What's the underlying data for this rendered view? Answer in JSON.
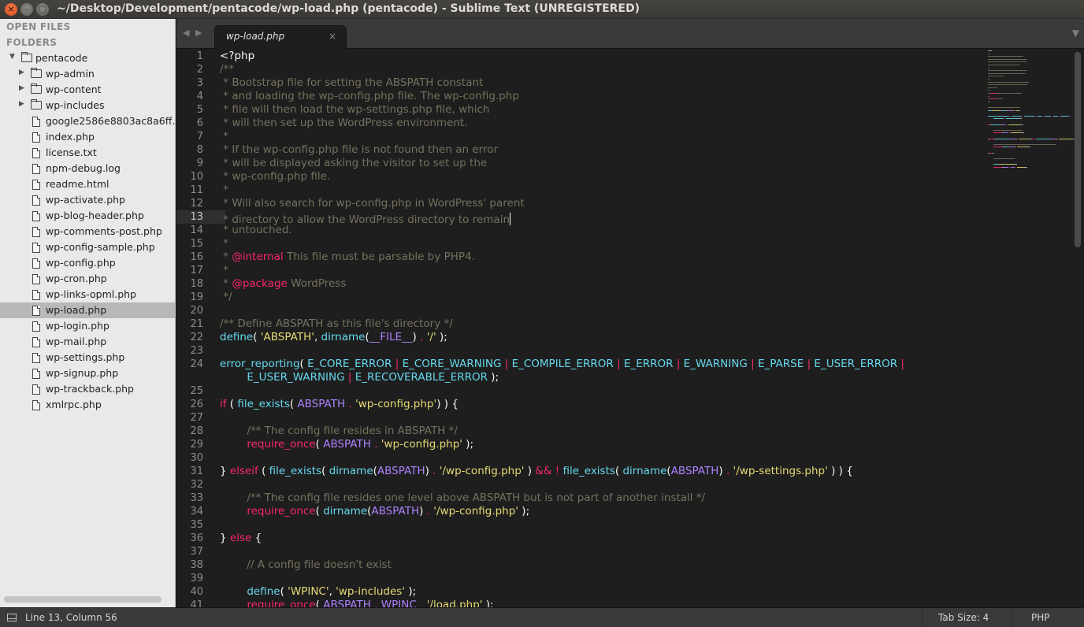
{
  "window": {
    "title": "~/Desktop/Development/pentacode/wp-load.php (pentacode) - Sublime Text (UNREGISTERED)",
    "close_glyph": "×",
    "min_glyph": "–",
    "max_glyph": "□"
  },
  "sidebar": {
    "open_files_label": "OPEN FILES",
    "folders_label": "FOLDERS",
    "root_folder": "pentacode",
    "items": [
      {
        "label": "wp-admin",
        "type": "folder"
      },
      {
        "label": "wp-content",
        "type": "folder"
      },
      {
        "label": "wp-includes",
        "type": "folder"
      },
      {
        "label": "google2586e8803ac8a6ff.html",
        "type": "file"
      },
      {
        "label": "index.php",
        "type": "file"
      },
      {
        "label": "license.txt",
        "type": "file"
      },
      {
        "label": "npm-debug.log",
        "type": "file"
      },
      {
        "label": "readme.html",
        "type": "file"
      },
      {
        "label": "wp-activate.php",
        "type": "file"
      },
      {
        "label": "wp-blog-header.php",
        "type": "file"
      },
      {
        "label": "wp-comments-post.php",
        "type": "file"
      },
      {
        "label": "wp-config-sample.php",
        "type": "file"
      },
      {
        "label": "wp-config.php",
        "type": "file"
      },
      {
        "label": "wp-cron.php",
        "type": "file"
      },
      {
        "label": "wp-links-opml.php",
        "type": "file"
      },
      {
        "label": "wp-load.php",
        "type": "file",
        "selected": true
      },
      {
        "label": "wp-login.php",
        "type": "file"
      },
      {
        "label": "wp-mail.php",
        "type": "file"
      },
      {
        "label": "wp-settings.php",
        "type": "file"
      },
      {
        "label": "wp-signup.php",
        "type": "file"
      },
      {
        "label": "wp-trackback.php",
        "type": "file"
      },
      {
        "label": "xmlrpc.php",
        "type": "file"
      }
    ]
  },
  "tabs": {
    "nav_prev": "◀",
    "nav_next": "▶",
    "active_tab": "wp-load.php",
    "close_glyph": "×",
    "dropdown_glyph": "▼"
  },
  "editor": {
    "current_line": 13,
    "lines": [
      {
        "n": "1",
        "t": [
          [
            "pl",
            "<?php"
          ]
        ]
      },
      {
        "n": "2",
        "t": [
          [
            "com",
            "/**"
          ]
        ]
      },
      {
        "n": "3",
        "t": [
          [
            "com",
            " * Bootstrap file for setting the ABSPATH constant"
          ]
        ]
      },
      {
        "n": "4",
        "t": [
          [
            "com",
            " * and loading the wp-config.php file. The wp-config.php"
          ]
        ]
      },
      {
        "n": "5",
        "t": [
          [
            "com",
            " * file will then load the wp-settings.php file, which"
          ]
        ]
      },
      {
        "n": "6",
        "t": [
          [
            "com",
            " * will then set up the WordPress environment."
          ]
        ]
      },
      {
        "n": "7",
        "t": [
          [
            "com",
            " *"
          ]
        ]
      },
      {
        "n": "8",
        "t": [
          [
            "com",
            " * If the wp-config.php file is not found then an error"
          ]
        ]
      },
      {
        "n": "9",
        "t": [
          [
            "com",
            " * will be displayed asking the visitor to set up the"
          ]
        ]
      },
      {
        "n": "10",
        "t": [
          [
            "com",
            " * wp-config.php file."
          ]
        ]
      },
      {
        "n": "11",
        "t": [
          [
            "com",
            " *"
          ]
        ]
      },
      {
        "n": "12",
        "t": [
          [
            "com",
            " * Will also search for wp-config.php in WordPress' parent"
          ]
        ]
      },
      {
        "n": "13",
        "t": [
          [
            "com",
            " * directory to allow the WordPress directory to remain"
          ]
        ]
      },
      {
        "n": "14",
        "t": [
          [
            "com",
            " * untouched."
          ]
        ]
      },
      {
        "n": "15",
        "t": [
          [
            "com",
            " *"
          ]
        ]
      },
      {
        "n": "16",
        "t": [
          [
            "com",
            " * "
          ],
          [
            "kw",
            "@internal"
          ],
          [
            "com",
            " This file must be parsable by PHP4."
          ]
        ]
      },
      {
        "n": "17",
        "t": [
          [
            "com",
            " *"
          ]
        ]
      },
      {
        "n": "18",
        "t": [
          [
            "com",
            " * "
          ],
          [
            "kw",
            "@package"
          ],
          [
            "com",
            " WordPress"
          ]
        ]
      },
      {
        "n": "19",
        "t": [
          [
            "com",
            " */"
          ]
        ]
      },
      {
        "n": "20",
        "t": []
      },
      {
        "n": "21",
        "t": [
          [
            "com",
            "/** Define ABSPATH as this file's directory */"
          ]
        ]
      },
      {
        "n": "22",
        "t": [
          [
            "fn",
            "define"
          ],
          [
            "pl",
            "( "
          ],
          [
            "str",
            "'ABSPATH'"
          ],
          [
            "pl",
            ", "
          ],
          [
            "fn",
            "dirname"
          ],
          [
            "pl",
            "("
          ],
          [
            "const",
            "__FILE__"
          ],
          [
            "pl",
            ") "
          ],
          [
            "op",
            "."
          ],
          [
            "pl",
            " "
          ],
          [
            "str",
            "'/'"
          ],
          [
            "pl",
            " );"
          ]
        ]
      },
      {
        "n": "23",
        "t": []
      },
      {
        "n": "24",
        "t": [
          [
            "fn",
            "error_reporting"
          ],
          [
            "pl",
            "( "
          ],
          [
            "fn",
            "E_CORE_ERROR"
          ],
          [
            "pl",
            " "
          ],
          [
            "op",
            "|"
          ],
          [
            "pl",
            " "
          ],
          [
            "fn",
            "E_CORE_WARNING"
          ],
          [
            "pl",
            " "
          ],
          [
            "op",
            "|"
          ],
          [
            "pl",
            " "
          ],
          [
            "fn",
            "E_COMPILE_ERROR"
          ],
          [
            "pl",
            " "
          ],
          [
            "op",
            "|"
          ],
          [
            "pl",
            " "
          ],
          [
            "fn",
            "E_ERROR"
          ],
          [
            "pl",
            " "
          ],
          [
            "op",
            "|"
          ],
          [
            "pl",
            " "
          ],
          [
            "fn",
            "E_WARNING"
          ],
          [
            "pl",
            " "
          ],
          [
            "op",
            "|"
          ],
          [
            "pl",
            " "
          ],
          [
            "fn",
            "E_PARSE"
          ],
          [
            "pl",
            " "
          ],
          [
            "op",
            "|"
          ],
          [
            "pl",
            " "
          ],
          [
            "fn",
            "E_USER_ERROR"
          ],
          [
            "pl",
            " "
          ],
          [
            "op",
            "|"
          ]
        ]
      },
      {
        "n": "",
        "t": [
          [
            "pl",
            "        "
          ],
          [
            "fn",
            "E_USER_WARNING"
          ],
          [
            "pl",
            " "
          ],
          [
            "op",
            "|"
          ],
          [
            "pl",
            " "
          ],
          [
            "fn",
            "E_RECOVERABLE_ERROR"
          ],
          [
            "pl",
            " );"
          ]
        ]
      },
      {
        "n": "25",
        "t": []
      },
      {
        "n": "26",
        "t": [
          [
            "kw",
            "if"
          ],
          [
            "pl",
            " ( "
          ],
          [
            "fn",
            "file_exists"
          ],
          [
            "pl",
            "( "
          ],
          [
            "const",
            "ABSPATH"
          ],
          [
            "pl",
            " "
          ],
          [
            "op",
            "."
          ],
          [
            "pl",
            " "
          ],
          [
            "str",
            "'wp-config.php'"
          ],
          [
            "pl",
            ") ) {"
          ]
        ]
      },
      {
        "n": "27",
        "t": []
      },
      {
        "n": "28",
        "t": [
          [
            "pl",
            "        "
          ],
          [
            "com",
            "/** The config file resides in ABSPATH */"
          ]
        ]
      },
      {
        "n": "29",
        "t": [
          [
            "pl",
            "        "
          ],
          [
            "kw",
            "require_once"
          ],
          [
            "pl",
            "( "
          ],
          [
            "const",
            "ABSPATH"
          ],
          [
            "pl",
            " "
          ],
          [
            "op",
            "."
          ],
          [
            "pl",
            " "
          ],
          [
            "str",
            "'wp-config.php'"
          ],
          [
            "pl",
            " );"
          ]
        ]
      },
      {
        "n": "30",
        "t": []
      },
      {
        "n": "31",
        "t": [
          [
            "pl",
            "} "
          ],
          [
            "kw",
            "elseif"
          ],
          [
            "pl",
            " ( "
          ],
          [
            "fn",
            "file_exists"
          ],
          [
            "pl",
            "( "
          ],
          [
            "fn",
            "dirname"
          ],
          [
            "pl",
            "("
          ],
          [
            "const",
            "ABSPATH"
          ],
          [
            "pl",
            ") "
          ],
          [
            "op",
            "."
          ],
          [
            "pl",
            " "
          ],
          [
            "str",
            "'/wp-config.php'"
          ],
          [
            "pl",
            " ) "
          ],
          [
            "op",
            "&& !"
          ],
          [
            "pl",
            " "
          ],
          [
            "fn",
            "file_exists"
          ],
          [
            "pl",
            "( "
          ],
          [
            "fn",
            "dirname"
          ],
          [
            "pl",
            "("
          ],
          [
            "const",
            "ABSPATH"
          ],
          [
            "pl",
            ") "
          ],
          [
            "op",
            "."
          ],
          [
            "pl",
            " "
          ],
          [
            "str",
            "'/wp-settings.php'"
          ],
          [
            "pl",
            " ) ) {"
          ]
        ]
      },
      {
        "n": "32",
        "t": []
      },
      {
        "n": "33",
        "t": [
          [
            "pl",
            "        "
          ],
          [
            "com",
            "/** The config file resides one level above ABSPATH but is not part of another install */"
          ]
        ]
      },
      {
        "n": "34",
        "t": [
          [
            "pl",
            "        "
          ],
          [
            "kw",
            "require_once"
          ],
          [
            "pl",
            "( "
          ],
          [
            "fn",
            "dirname"
          ],
          [
            "pl",
            "("
          ],
          [
            "const",
            "ABSPATH"
          ],
          [
            "pl",
            ") "
          ],
          [
            "op",
            "."
          ],
          [
            "pl",
            " "
          ],
          [
            "str",
            "'/wp-config.php'"
          ],
          [
            "pl",
            " );"
          ]
        ]
      },
      {
        "n": "35",
        "t": []
      },
      {
        "n": "36",
        "t": [
          [
            "pl",
            "} "
          ],
          [
            "kw",
            "else"
          ],
          [
            "pl",
            " {"
          ]
        ]
      },
      {
        "n": "37",
        "t": []
      },
      {
        "n": "38",
        "t": [
          [
            "pl",
            "        "
          ],
          [
            "com",
            "// A config file doesn't exist"
          ]
        ]
      },
      {
        "n": "39",
        "t": []
      },
      {
        "n": "40",
        "t": [
          [
            "pl",
            "        "
          ],
          [
            "fn",
            "define"
          ],
          [
            "pl",
            "( "
          ],
          [
            "str",
            "'WPINC'"
          ],
          [
            "pl",
            ", "
          ],
          [
            "str",
            "'wp-includes'"
          ],
          [
            "pl",
            " );"
          ]
        ]
      },
      {
        "n": "41",
        "t": [
          [
            "pl",
            "        "
          ],
          [
            "kw",
            "require_once"
          ],
          [
            "pl",
            "( "
          ],
          [
            "const",
            "ABSPATH"
          ],
          [
            "pl",
            " "
          ],
          [
            "op",
            "."
          ],
          [
            "pl",
            " "
          ],
          [
            "const",
            "WPINC"
          ],
          [
            "pl",
            " "
          ],
          [
            "op",
            "."
          ],
          [
            "pl",
            " "
          ],
          [
            "str",
            "'/load.php'"
          ],
          [
            "pl",
            " );"
          ]
        ]
      }
    ]
  },
  "statusbar": {
    "position": "Line 13, Column 56",
    "tab_size": "Tab Size: 4",
    "syntax": "PHP"
  },
  "colors": {
    "comment": "#75715e",
    "keyword": "#f92672",
    "function": "#66d9ef",
    "string": "#e6db74",
    "constant": "#ae81ff",
    "background": "#1e1e1e"
  }
}
